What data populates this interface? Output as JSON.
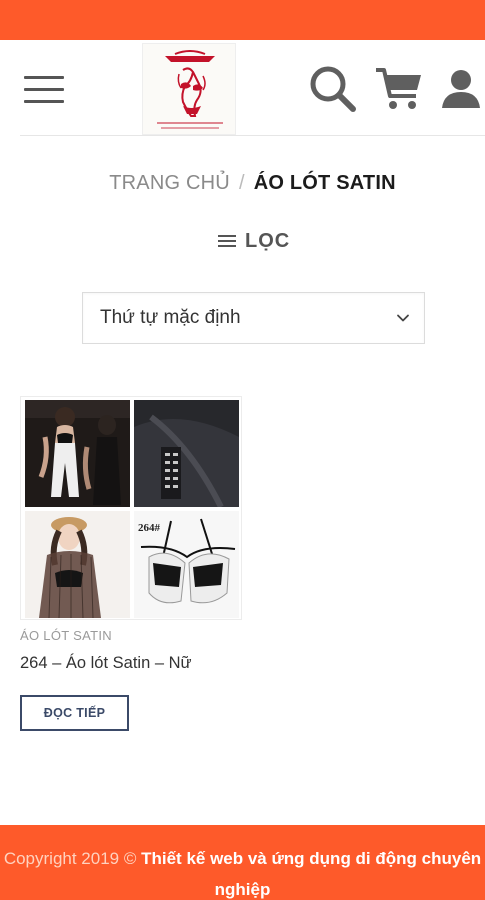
{
  "header": {
    "menu_icon": "hamburger-menu-icon",
    "logo_icon": "bikini-silhouette-logo",
    "logo_small_text": "WOMAN'S STORE",
    "search_icon": "search-icon",
    "cart_icon": "shopping-cart-icon",
    "account_icon": "user-account-icon"
  },
  "breadcrumb": {
    "home_label": "TRANG CHỦ",
    "separator": "/",
    "current_label": "ÁO LÓT SATIN"
  },
  "filter": {
    "label": "LỌC",
    "icon": "filter-lines-icon"
  },
  "sort": {
    "selected": "Thứ tự mặc định",
    "icon": "chevron-down-icon"
  },
  "products": [
    {
      "category": "ÁO LÓT SATIN",
      "title": "264 – Áo lót Satin – Nữ",
      "image_caption": "264#",
      "button_label": "ĐỌC TIẾP"
    }
  ],
  "footer": {
    "prefix": "Copyright 2019 ©",
    "link_text": "Thiết kế web và ứng dụng di động chuyên nghiệp"
  },
  "colors": {
    "brand_orange": "#fe5a2a",
    "button_border": "#3b4a68",
    "logo_red": "#c3122a"
  }
}
